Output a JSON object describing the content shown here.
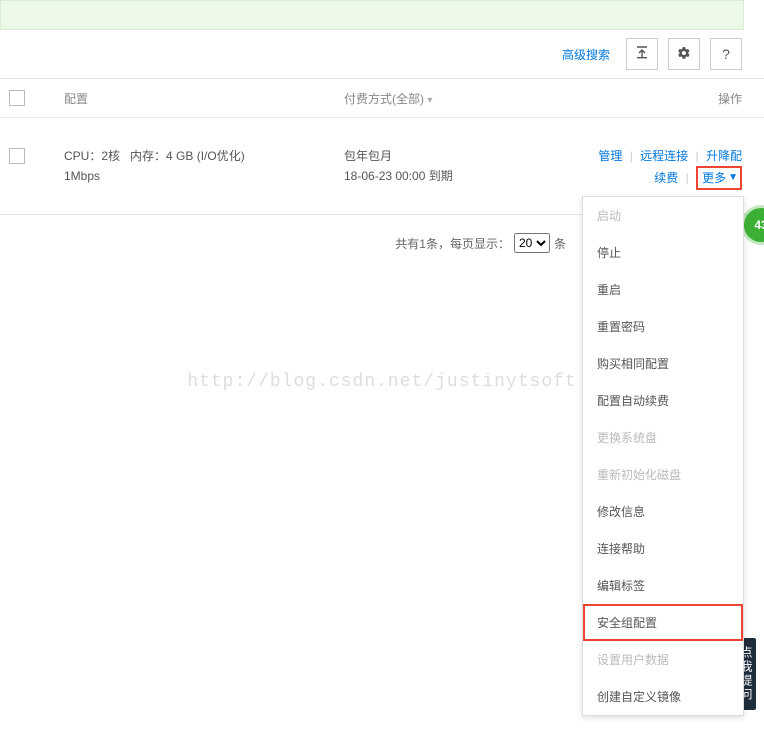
{
  "toolbar": {
    "advanced_search": "高级搜索"
  },
  "headers": {
    "config": "配置",
    "payment": "付费方式(全部)",
    "operation": "操作"
  },
  "row": {
    "cpu_label": "CPU：",
    "cpu_value": "2核",
    "mem_label": "内存：",
    "mem_value": "4 GB (I/O优化)",
    "bandwidth": "1Mbps",
    "pay_mode": "包年包月",
    "expire": "18-06-23 00:00 到期"
  },
  "ops": {
    "manage": "管理",
    "remote": "远程连接",
    "upgrade": "升降配",
    "renew": "续费",
    "more": "更多"
  },
  "pager": {
    "prefix": "共有1条，每页显示：",
    "size": "20",
    "suffix": "条"
  },
  "dropdown": {
    "items": [
      {
        "label": "启动",
        "disabled": true
      },
      {
        "label": "停止",
        "disabled": false
      },
      {
        "label": "重启",
        "disabled": false
      },
      {
        "label": "重置密码",
        "disabled": false
      },
      {
        "label": "购买相同配置",
        "disabled": false
      },
      {
        "label": "配置自动续费",
        "disabled": false
      },
      {
        "label": "更换系统盘",
        "disabled": true
      },
      {
        "label": "重新初始化磁盘",
        "disabled": true
      },
      {
        "label": "修改信息",
        "disabled": false
      },
      {
        "label": "连接帮助",
        "disabled": false
      },
      {
        "label": "编辑标签",
        "disabled": false
      },
      {
        "label": "安全组配置",
        "disabled": false,
        "highlight": true
      },
      {
        "label": "设置用户数据",
        "disabled": true
      },
      {
        "label": "创建自定义镜像",
        "disabled": false
      }
    ]
  },
  "badge": "43",
  "watermark": "http://blog.csdn.net/justinytsoft",
  "side_tab": "点我提问"
}
